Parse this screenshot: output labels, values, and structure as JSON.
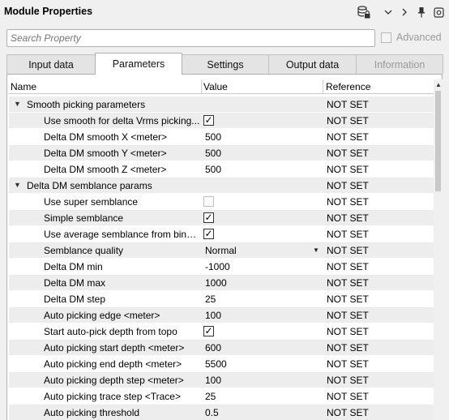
{
  "window": {
    "title": "Module Properties",
    "icons": [
      "database-lock-icon",
      "chevron-down-icon",
      "chevron-right-icon",
      "pin-icon",
      "settings-icon"
    ]
  },
  "search": {
    "placeholder": "Search Property"
  },
  "advanced": {
    "label": "Advanced",
    "checked": false
  },
  "tabs": [
    {
      "label": "Input data",
      "active": false,
      "enabled": true
    },
    {
      "label": "Parameters",
      "active": true,
      "enabled": true
    },
    {
      "label": "Settings",
      "active": false,
      "enabled": true
    },
    {
      "label": "Output data",
      "active": false,
      "enabled": true
    },
    {
      "label": "Information",
      "active": false,
      "enabled": false
    }
  ],
  "table": {
    "columns": [
      "Name",
      "Value",
      "Reference"
    ],
    "rows": [
      {
        "type": "group",
        "name": "Smooth picking parameters",
        "reference": "NOT SET"
      },
      {
        "type": "check",
        "name": "Use smooth for delta Vrms picking...",
        "checked": true,
        "reference": "NOT SET"
      },
      {
        "type": "text",
        "name": "Delta DM smooth X <meter>",
        "value": "500",
        "reference": "NOT SET"
      },
      {
        "type": "text",
        "name": "Delta DM smooth Y <meter>",
        "value": "500",
        "reference": "NOT SET"
      },
      {
        "type": "text",
        "name": "Delta DM smooth Z <meter>",
        "value": "500",
        "reference": "NOT SET"
      },
      {
        "type": "group",
        "name": "Delta DM semblance params",
        "reference": "NOT SET"
      },
      {
        "type": "check",
        "name": "Use super semblance",
        "checked": false,
        "reference": "NOT SET"
      },
      {
        "type": "check",
        "name": "Simple semblance",
        "checked": true,
        "reference": "NOT SET"
      },
      {
        "type": "check",
        "name": "Use average semblance from bins ...",
        "checked": true,
        "reference": "NOT SET"
      },
      {
        "type": "select",
        "name": "Semblance quality",
        "value": "Normal",
        "reference": "NOT SET"
      },
      {
        "type": "text",
        "name": "Delta DM min",
        "value": "-1000",
        "reference": "NOT SET"
      },
      {
        "type": "text",
        "name": "Delta DM max",
        "value": "1000",
        "reference": "NOT SET"
      },
      {
        "type": "text",
        "name": "Delta DM step",
        "value": "25",
        "reference": "NOT SET"
      },
      {
        "type": "text",
        "name": "Auto picking edge <meter>",
        "value": "100",
        "reference": "NOT SET"
      },
      {
        "type": "check",
        "name": "Start auto-pick depth from topo",
        "checked": true,
        "reference": "NOT SET"
      },
      {
        "type": "text",
        "name": "Auto picking start depth <meter>",
        "value": "600",
        "reference": "NOT SET"
      },
      {
        "type": "text",
        "name": "Auto picking end depth <meter>",
        "value": "5500",
        "reference": "NOT SET"
      },
      {
        "type": "text",
        "name": "Auto picking depth step <meter>",
        "value": "100",
        "reference": "NOT SET"
      },
      {
        "type": "text",
        "name": "Auto picking trace step <Trace>",
        "value": "25",
        "reference": "NOT SET"
      },
      {
        "type": "text",
        "name": "Auto picking threshold",
        "value": "0.5",
        "reference": "NOT SET"
      }
    ]
  }
}
